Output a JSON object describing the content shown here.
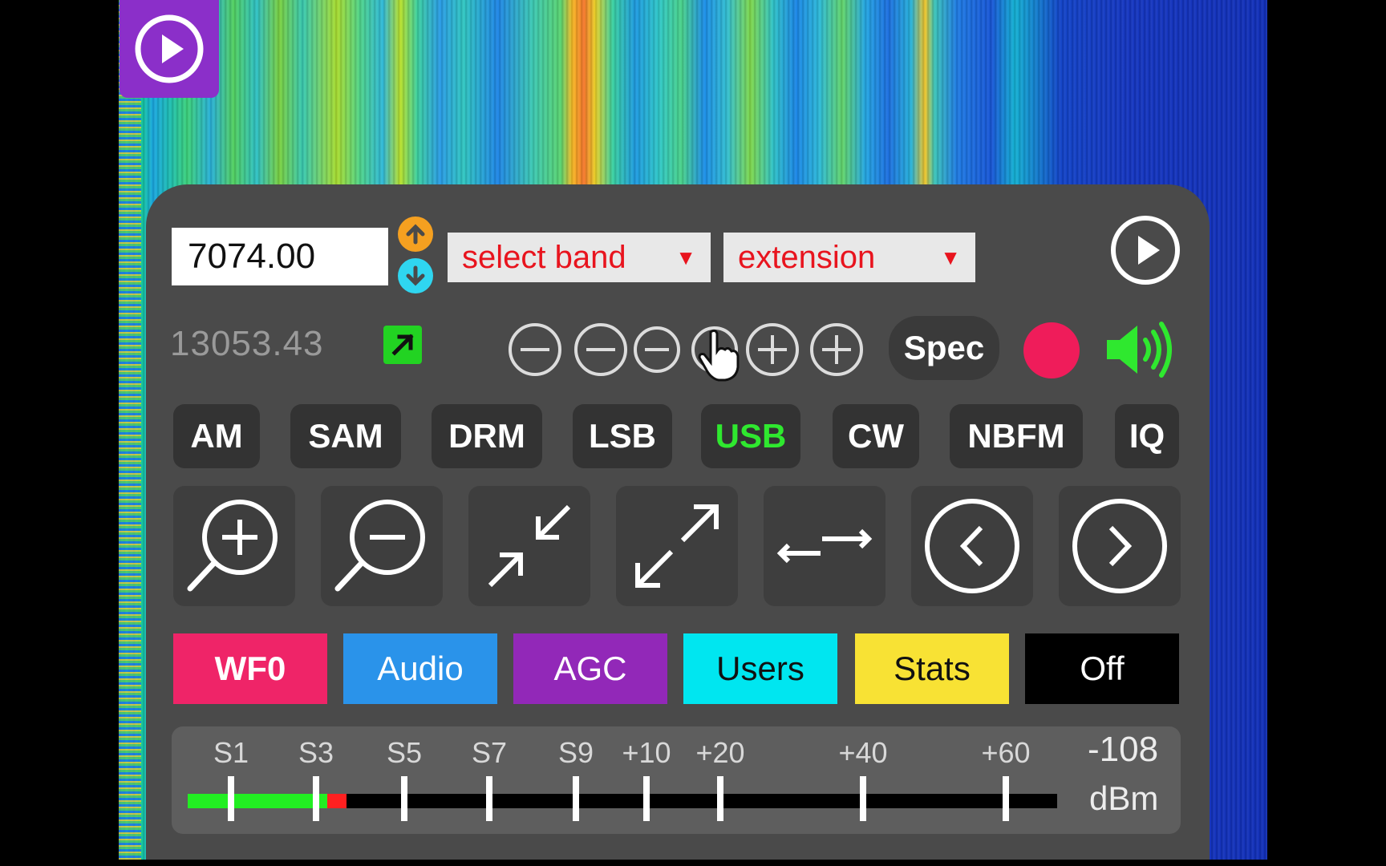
{
  "frequency": {
    "value": "7074.00"
  },
  "band_select": {
    "label": "select band"
  },
  "extension_select": {
    "label": "extension"
  },
  "secondary_frequency": "13053.43",
  "spec_label": "Spec",
  "modes": [
    {
      "label": "AM",
      "selected": false
    },
    {
      "label": "SAM",
      "selected": false
    },
    {
      "label": "DRM",
      "selected": false
    },
    {
      "label": "LSB",
      "selected": false
    },
    {
      "label": "USB",
      "selected": true
    },
    {
      "label": "CW",
      "selected": false
    },
    {
      "label": "NBFM",
      "selected": false
    },
    {
      "label": "IQ",
      "selected": false
    }
  ],
  "tabs": [
    {
      "label": "WF0",
      "color": "#ef2468",
      "text_color": "#ffffff",
      "bold": true
    },
    {
      "label": "Audio",
      "color": "#2a93ea",
      "text_color": "#ffffff",
      "bold": false
    },
    {
      "label": "AGC",
      "color": "#9228b8",
      "text_color": "#ffffff",
      "bold": false
    },
    {
      "label": "Users",
      "color": "#00e6f0",
      "text_color": "#111111",
      "bold": false
    },
    {
      "label": "Stats",
      "color": "#f8e234",
      "text_color": "#111111",
      "bold": false
    },
    {
      "label": "Off",
      "color": "#000000",
      "text_color": "#ffffff",
      "bold": false
    }
  ],
  "smeter": {
    "scale": [
      "S1",
      "S3",
      "S5",
      "S7",
      "S9",
      "+10",
      "+20",
      "+40",
      "+60"
    ],
    "value": "-108",
    "unit": "dBm",
    "level_fraction": 0.17
  },
  "colors": {
    "panel": "#4a4a4a",
    "accent_play": "#8b2fc9",
    "selected_mode": "#2fe82f",
    "record": "#ef1c5a",
    "select_text": "#e8141e"
  },
  "icons": [
    "play-icon",
    "freq-up-icon",
    "freq-down-icon",
    "external-link-icon",
    "zoom-out-icon",
    "zoom-in-icon",
    "record-icon",
    "speaker-icon",
    "magnify-plus-icon",
    "magnify-minus-icon",
    "shrink-icon",
    "expand-icon",
    "swap-horizontal-icon",
    "chevron-left-icon",
    "chevron-right-icon"
  ]
}
